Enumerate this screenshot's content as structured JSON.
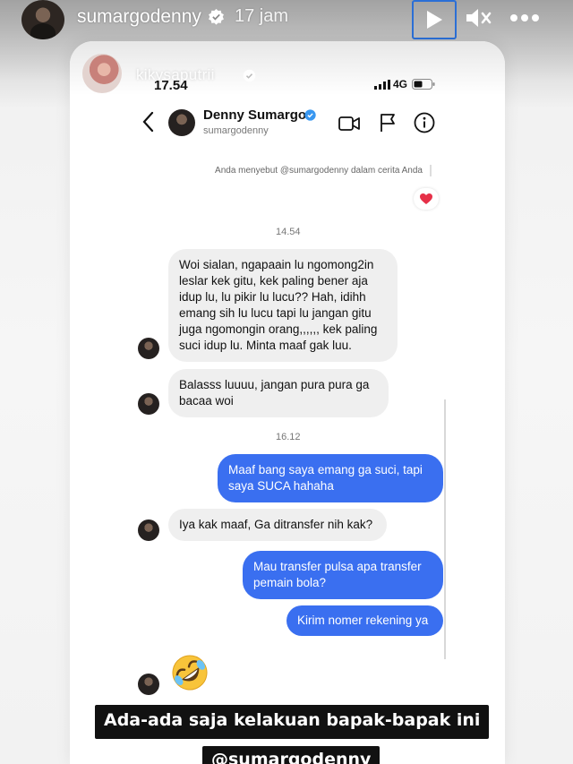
{
  "story": {
    "username": "sumargodenny",
    "time": "17 jam",
    "icons": [
      "play-icon",
      "mute-icon",
      "more-icon",
      "verified-icon"
    ]
  },
  "screenshot": {
    "status_bar": {
      "overlay_username": "kikysaputrii",
      "clock": "17.54",
      "network": "4G"
    },
    "chat_header": {
      "name": "Denny Sumargo",
      "handle": "sumargodenny"
    },
    "mention_text": "Anda menyebut @sumargodenny dalam cerita Anda",
    "reaction": "heart",
    "messages_group1": {
      "time": "14.54",
      "msg1": "Woi sialan, ngapaain lu ngomong2in leslar kek gitu, kek paling bener aja idup lu, lu pikir lu lucu?? Hah, idihh emang sih lu lucu tapi lu jangan gitu juga ngomongin orang,,,,,, kek paling suci idup lu. Minta maaf gak luu.",
      "msg2": "Balasss luuuu, jangan pura pura ga bacaa woi"
    },
    "messages_group2": {
      "time": "16.12",
      "out1": "Maaf bang saya emang ga suci, tapi saya SUCA hahaha",
      "in1": "Iya kak maaf, Ga ditransfer nih kak?",
      "out2": "Mau transfer pulsa apa transfer pemain bola?",
      "out3": "Kirim nomer rekening ya",
      "emoji": "rolling-on-floor-laughing"
    }
  },
  "captions": {
    "line1": "Ada-ada saja kelakuan bapak-bapak ini",
    "line2": "@sumargodenny"
  },
  "colors": {
    "outgoing_bubble": "#3a6ff0",
    "incoming_bubble": "#efefef",
    "verified": "#3897f0",
    "play_highlight": "#2b6fd6"
  }
}
